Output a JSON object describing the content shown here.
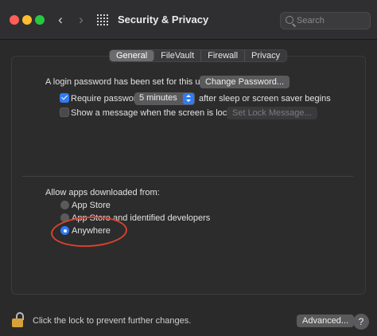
{
  "window": {
    "title": "Security & Privacy",
    "search_placeholder": "Search"
  },
  "tabs": [
    {
      "label": "General",
      "active": true
    },
    {
      "label": "FileVault",
      "active": false
    },
    {
      "label": "Firewall",
      "active": false
    },
    {
      "label": "Privacy",
      "active": false
    }
  ],
  "general": {
    "login_password_text": "A login password has been set for this user",
    "change_password_label": "Change Password...",
    "require_password": {
      "checked": true,
      "label": "Require password",
      "delay_value": "5 minutes",
      "suffix": "after sleep or screen saver begins"
    },
    "show_message": {
      "checked": false,
      "label": "Show a message when the screen is locked",
      "button_label": "Set Lock Message..."
    },
    "allow_apps": {
      "label": "Allow apps downloaded from:",
      "options": [
        {
          "label": "App Store",
          "selected": false
        },
        {
          "label": "App Store and identified developers",
          "selected": false
        },
        {
          "label": "Anywhere",
          "selected": true
        }
      ]
    }
  },
  "footer": {
    "lock_text": "Click the lock to prevent further changes.",
    "advanced_label": "Advanced...",
    "help_label": "?"
  },
  "colors": {
    "accent": "#2f7cf6",
    "annotation": "#d9412f"
  }
}
